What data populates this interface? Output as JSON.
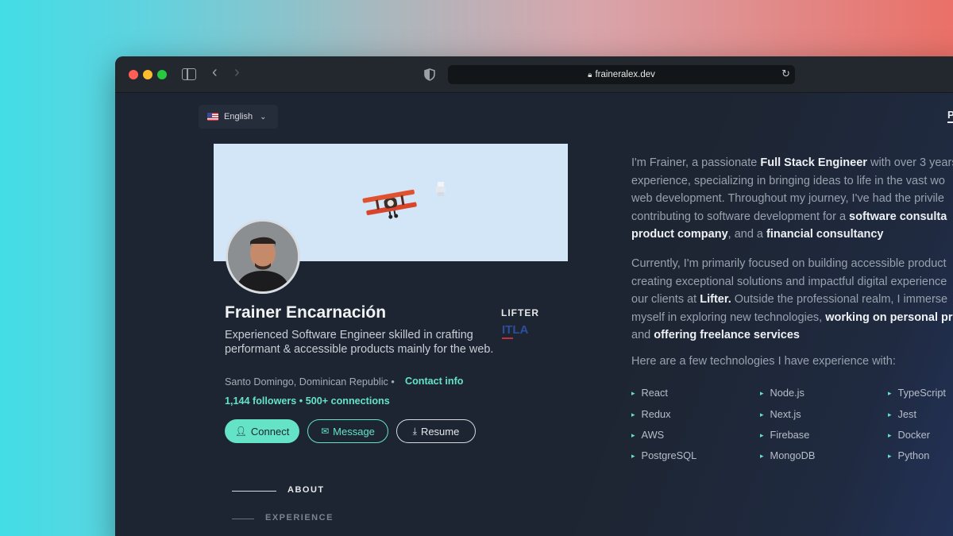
{
  "browser": {
    "url": "fraineralex.dev",
    "icons": [
      "sidebar-icon",
      "back-icon",
      "forward-icon",
      "shield-icon",
      "lock-icon",
      "reload-icon"
    ]
  },
  "language": {
    "label": "English"
  },
  "header": {
    "partial_nav": "P"
  },
  "profile": {
    "name": "Frainer Encarnación",
    "headline": "Experienced Software Engineer skilled in crafting performant & accessible products mainly for the web.",
    "location": "Santo Domingo, Dominican Republic",
    "separator": "•",
    "contact_label": "Contact info",
    "followers": "1,144 followers • 500+ connections",
    "company": "LIFTER"
  },
  "actions": {
    "connect": "Connect",
    "message": "Message",
    "resume": "Resume"
  },
  "section_nav": {
    "about": "ABOUT",
    "experience": "EXPERIENCE"
  },
  "about": {
    "p1": [
      {
        "t": "I'm Frainer, a passionate "
      },
      {
        "b": "Full Stack Engineer"
      },
      {
        "t": " with over 3 years"
      }
    ],
    "p1_lines": [
      "experience, specializing in bringing ideas to life in the vast wo",
      "web development. Throughout my journey, I've had the privile"
    ],
    "p1_line4_pre": "contributing to software development for a ",
    "p1_line4_bold": "software consulta",
    "p1_line5_bold1": "product company",
    "p1_line5_mid": ", and a ",
    "p1_line5_bold2": "financial consultancy",
    "p2_line1": "Currently, I'm primarily focused on building accessible product",
    "p2_line2": "creating exceptional solutions and impactful digital experience",
    "p2_line3_pre": "our clients at ",
    "p2_line3_bold": "Lifter.",
    "p2_line3_post": " Outside the professional realm, I immerse",
    "p2_line4_pre": "myself in exploring new technologies, ",
    "p2_line4_bold": "working on personal pro",
    "p2_line5_pre": "and ",
    "p2_line5_bold": "offering freelance services",
    "tech_intro": "Here are a few technologies I have experience with:",
    "technologies": [
      "React",
      "Node.js",
      "TypeScript",
      "Redux",
      "Next.js",
      "Jest",
      "AWS",
      "Firebase",
      "Docker",
      "PostgreSQL",
      "MongoDB",
      "Python"
    ]
  }
}
